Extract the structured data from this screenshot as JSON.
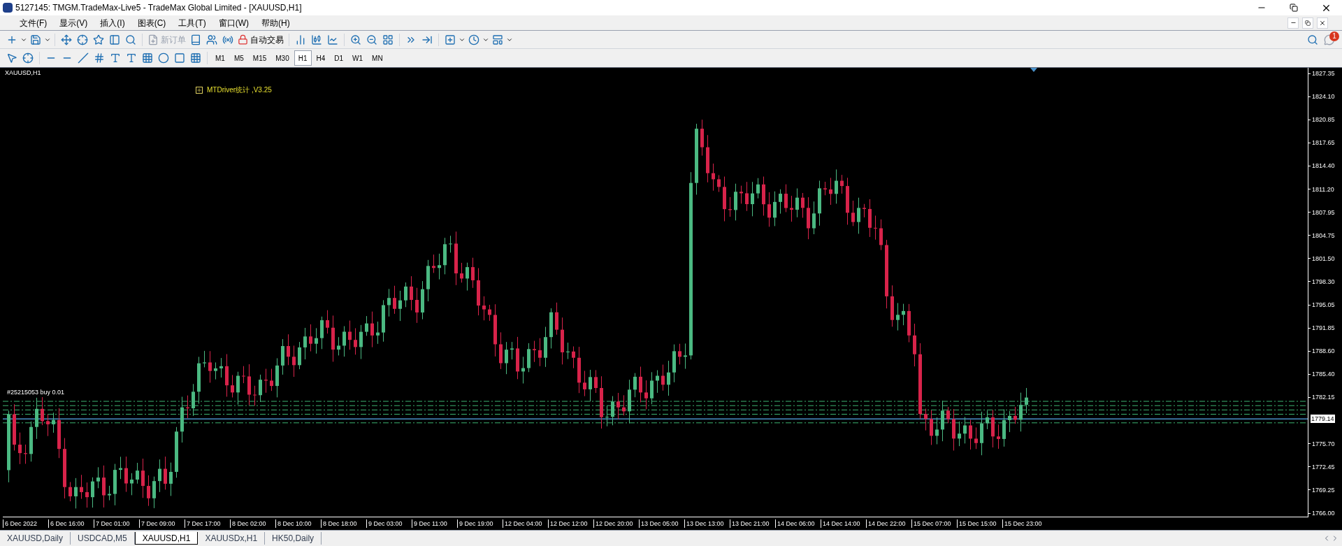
{
  "window": {
    "title": "5127145: TMGM.TradeMax-Live5 - TradeMax Global Limited - [XAUUSD,H1]"
  },
  "menu": [
    "文件(F)",
    "显示(V)",
    "插入(I)",
    "图表(C)",
    "工具(T)",
    "窗口(W)",
    "帮助(H)"
  ],
  "toolbar": {
    "new_order": {
      "label": "新订单",
      "disabled": true
    },
    "auto_trading": {
      "label": "自动交易"
    },
    "notifications": {
      "count": "1"
    }
  },
  "timeframes": [
    {
      "label": "M1",
      "selected": false
    },
    {
      "label": "M5",
      "selected": false
    },
    {
      "label": "M15",
      "selected": false
    },
    {
      "label": "M30",
      "selected": false
    },
    {
      "label": "H1",
      "selected": true
    },
    {
      "label": "H4",
      "selected": false
    },
    {
      "label": "D1",
      "selected": false
    },
    {
      "label": "W1",
      "selected": false
    },
    {
      "label": "MN",
      "selected": false
    }
  ],
  "chart": {
    "symbol": "XAUUSD,H1",
    "indicator": "MTDriver统计 ,V3.25",
    "order_label": "#25215053 buy 0.01",
    "current_price": "1779.14",
    "price_ticks": [
      "1827.35",
      "1824.10",
      "1820.85",
      "1817.65",
      "1814.40",
      "1811.20",
      "1807.95",
      "1804.75",
      "1801.50",
      "1798.30",
      "1795.05",
      "1791.85",
      "1788.60",
      "1785.40",
      "1782.15",
      "1775.70",
      "1772.45",
      "1769.25",
      "1766.00"
    ],
    "time_labels": [
      "6 Dec 2022",
      "6 Dec 16:00",
      "7 Dec 01:00",
      "7 Dec 09:00",
      "7 Dec 17:00",
      "8 Dec 02:00",
      "8 Dec 10:00",
      "8 Dec 18:00",
      "9 Dec 03:00",
      "9 Dec 11:00",
      "9 Dec 19:00",
      "12 Dec 04:00",
      "12 Dec 12:00",
      "12 Dec 20:00",
      "13 Dec 05:00",
      "13 Dec 13:00",
      "13 Dec 21:00",
      "14 Dec 06:00",
      "14 Dec 14:00",
      "14 Dec 22:00",
      "15 Dec 07:00",
      "15 Dec 15:00",
      "15 Dec 23:00"
    ]
  },
  "tabs": [
    {
      "label": "XAUUSD,Daily",
      "selected": false
    },
    {
      "label": "USDCAD,M5",
      "selected": false
    },
    {
      "label": "XAUUSD,H1",
      "selected": true
    },
    {
      "label": "XAUUSDx,H1",
      "selected": false
    },
    {
      "label": "HK50,Daily",
      "selected": false
    }
  ]
}
